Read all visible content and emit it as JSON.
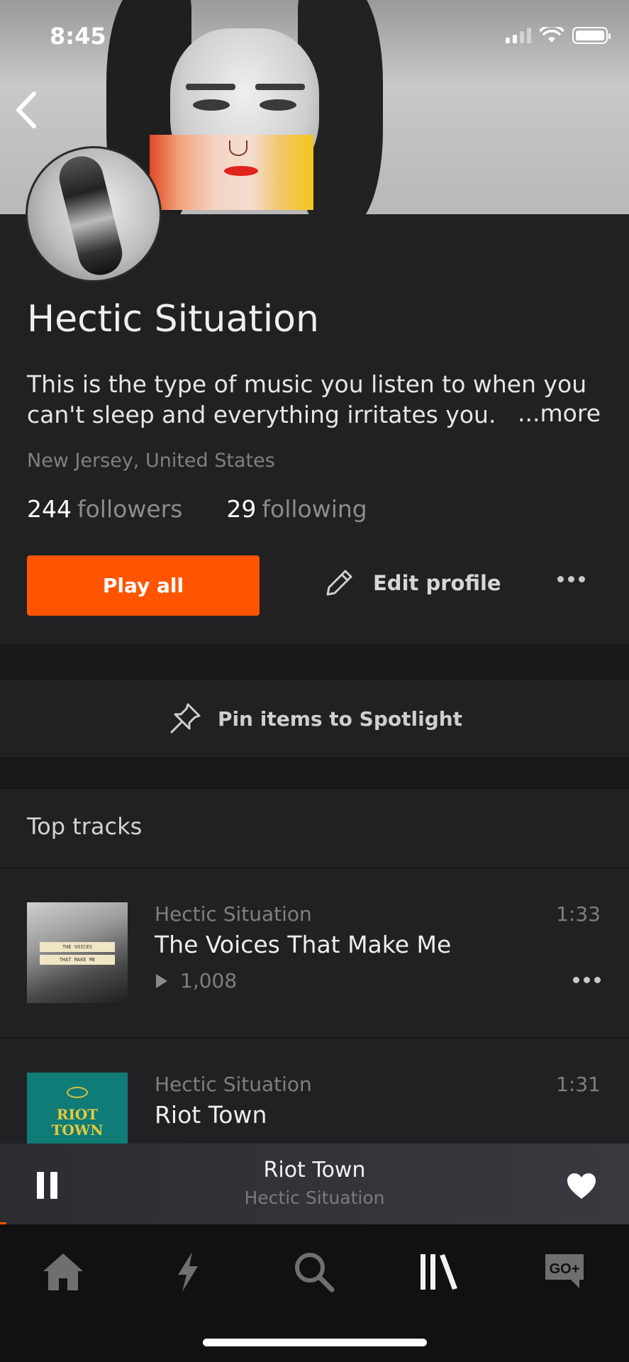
{
  "status_bar": {
    "time": "8:45"
  },
  "profile": {
    "name": "Hectic Situation",
    "bio": "This is the type of music you listen to when you can't sleep and everything irritates you.",
    "bio_more": "...more",
    "location": "New Jersey, United States",
    "followers_count": "244",
    "followers_label": "followers",
    "following_count": "29",
    "following_label": "following"
  },
  "actions": {
    "play_all": "Play all",
    "edit_profile": "Edit profile"
  },
  "spotlight": {
    "label": "Pin items to Spotlight"
  },
  "top_tracks": {
    "title": "Top tracks",
    "items": [
      {
        "artist": "Hectic Situation",
        "title": "The Voices That Make Me",
        "duration": "1:33",
        "plays": "1,008",
        "art_text": [
          "THE VOICES",
          "THAT MAKE ME"
        ]
      },
      {
        "artist": "Hectic Situation",
        "title": "Riot Town",
        "duration": "1:31",
        "art_text": [
          "RIOT",
          "TOWN"
        ]
      }
    ]
  },
  "mini_player": {
    "title": "Riot Town",
    "artist": "Hectic Situation",
    "progress_fraction": 0.01
  },
  "tabbar": {
    "items": [
      {
        "icon": "home-icon"
      },
      {
        "icon": "stream-icon"
      },
      {
        "icon": "search-icon"
      },
      {
        "icon": "library-icon"
      },
      {
        "icon": "go-plus-icon",
        "label": "GO+"
      }
    ]
  },
  "colors": {
    "accent": "#ff5500",
    "background": "#212023",
    "tabbar": "#111112"
  }
}
